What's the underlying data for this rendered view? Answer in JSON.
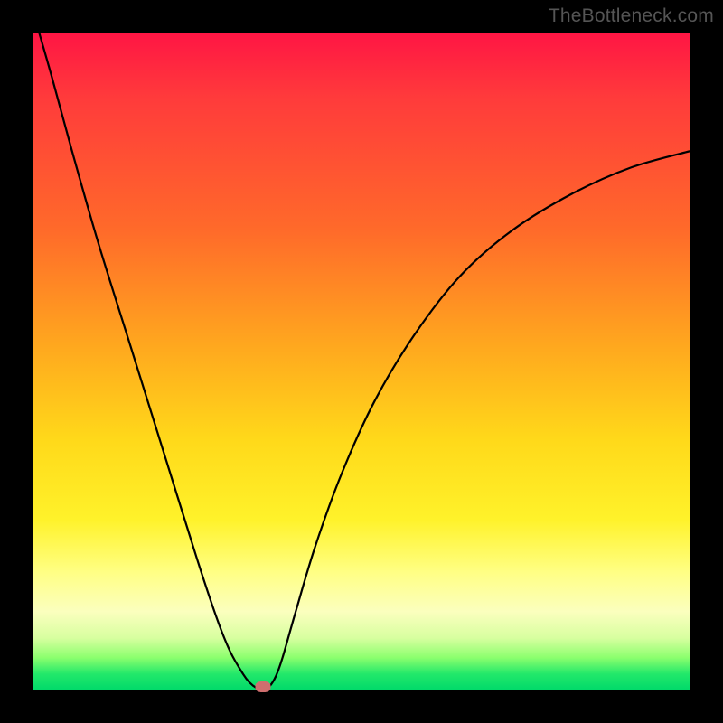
{
  "watermark": "TheBottleneck.com",
  "chart_data": {
    "type": "line",
    "title": "",
    "xlabel": "",
    "ylabel": "",
    "xlim": [
      0,
      100
    ],
    "ylim": [
      0,
      100
    ],
    "grid": false,
    "legend": false,
    "series": [
      {
        "name": "curve",
        "x": [
          1,
          3,
          6,
          10,
          15,
          20,
          25,
          28,
          30,
          32,
          33,
          34,
          35,
          36,
          37,
          38,
          40,
          43,
          47,
          52,
          58,
          65,
          73,
          82,
          91,
          100
        ],
        "y": [
          100,
          93,
          82,
          68,
          52,
          36,
          20,
          11,
          6,
          2.5,
          1.2,
          0.4,
          0,
          0.6,
          2.2,
          5,
          12,
          22,
          33,
          44,
          54,
          63,
          70,
          75.5,
          79.5,
          82
        ]
      }
    ],
    "marker": {
      "x": 35,
      "y": 0.6
    },
    "background_gradient": {
      "top": "#ff1544",
      "bottom": "#00d96a"
    }
  }
}
